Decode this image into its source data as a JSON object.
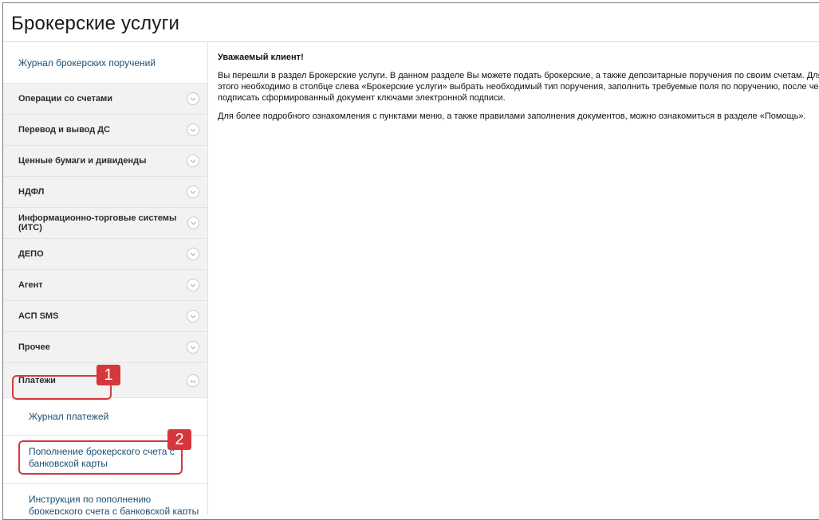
{
  "header": {
    "title": "Брокерские услуги"
  },
  "sidebar": {
    "top_link": "Журнал брокерских поручений",
    "sections": [
      {
        "label": "Операции со счетами",
        "state": "collapsed"
      },
      {
        "label": "Перевод и вывод ДС",
        "state": "collapsed"
      },
      {
        "label": "Ценные бумаги и дивиденды",
        "state": "collapsed"
      },
      {
        "label": "НДФЛ",
        "state": "collapsed"
      },
      {
        "label": "Информационно-торговые системы (ИТС)",
        "state": "collapsed"
      },
      {
        "label": "ДЕПО",
        "state": "collapsed"
      },
      {
        "label": "Агент",
        "state": "collapsed"
      },
      {
        "label": "АСП SMS",
        "state": "collapsed"
      },
      {
        "label": "Прочее",
        "state": "collapsed"
      },
      {
        "label": "Платежи",
        "state": "expanded"
      }
    ],
    "payments_items": [
      {
        "label": "Журнал платежей"
      },
      {
        "label_line1": "Пополнение брокерского счета с",
        "label_line2": "банковской карты"
      },
      {
        "label_line1": "Инструкция по пополнению",
        "label_line2": "брокерского счета с банковской карты"
      }
    ]
  },
  "content": {
    "greeting": "Уважаемый клиент!",
    "paragraph1_line1": "Вы перешли в раздел Брокерские услуги. В данном разделе Вы можете подать брокерские, а также депозитарные поручения по своим счетам. Для",
    "paragraph1_line2": "этого необходимо в столбце слева «Брокерские услуги» выбрать необходимый тип поручения, заполнить требуемые поля по поручению, после чего",
    "paragraph1_line3": "подписать сформированный документ ключами электронной подписи.",
    "paragraph2": "Для более подробного ознакомления с пунктами меню, а также правилами заполнения документов, можно ознакомиться в разделе «Помощь»."
  },
  "annotations": [
    {
      "number": "1",
      "target": "Платежи"
    },
    {
      "number": "2",
      "target": "Пополнение брокерского счета с банковской карты"
    }
  ],
  "icons": {
    "collapsed": "chevron-down-icon",
    "expanded": "chevron-up-icon"
  },
  "colors": {
    "annotation": "#d6373d",
    "link": "#1d4f73",
    "sidebar_bg": "#f2f2f2"
  }
}
